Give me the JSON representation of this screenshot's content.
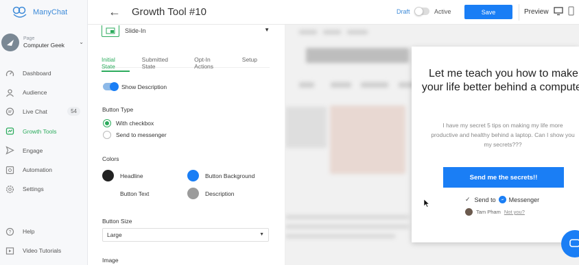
{
  "app": {
    "name": "ManyChat"
  },
  "page": {
    "kicker": "Page",
    "name": "Computer Geek"
  },
  "sidebar": {
    "items": [
      {
        "label": "Dashboard",
        "icon": "speedometer-icon"
      },
      {
        "label": "Audience",
        "icon": "person-icon"
      },
      {
        "label": "Live Chat",
        "icon": "chat-icon",
        "badge": "54"
      },
      {
        "label": "Growth Tools",
        "icon": "growth-icon",
        "active": true
      },
      {
        "label": "Engage",
        "icon": "send-icon"
      },
      {
        "label": "Automation",
        "icon": "automation-icon"
      },
      {
        "label": "Settings",
        "icon": "gear-icon"
      }
    ],
    "bottom": [
      {
        "label": "Help",
        "icon": "help-icon"
      },
      {
        "label": "Video Tutorials",
        "icon": "video-icon"
      }
    ]
  },
  "header": {
    "title": "Growth Tool #10",
    "status_draft": "Draft",
    "status_active": "Active",
    "save_label": "Save",
    "preview_label": "Preview"
  },
  "editor": {
    "widget_type": "Slide-In",
    "tabs": [
      "Initial State",
      "Submitted State",
      "Opt-In Actions",
      "Setup"
    ],
    "show_description_label": "Show Description",
    "button_type": {
      "title": "Button Type",
      "options": [
        "With checkbox",
        "Send to messenger"
      ],
      "selected": "With checkbox"
    },
    "colors": {
      "title": "Colors",
      "items": [
        {
          "label": "Headline",
          "color": "#222222"
        },
        {
          "label": "Button Background",
          "color": "#1a7ef5"
        },
        {
          "label": "Button Text",
          "color": "#ffffff"
        },
        {
          "label": "Description",
          "color": "#9b9b9b"
        }
      ]
    },
    "button_size": {
      "title": "Button Size",
      "value": "Large"
    },
    "image_title": "Image"
  },
  "preview": {
    "headline": "Let me teach you how to make your life better behind a computer",
    "description": "I have my secret 5 tips on making my life more productive and healthy behind a laptop. Can I show you my secrets???",
    "button_label": "Send me the secrets!!",
    "send_to_label": "Send to",
    "messenger_label": "Messenger",
    "user_name": "Tam Pham",
    "not_you": "Not you?"
  },
  "colors": {
    "accent_green": "#2bab5c",
    "primary_blue": "#1a7ef5"
  }
}
